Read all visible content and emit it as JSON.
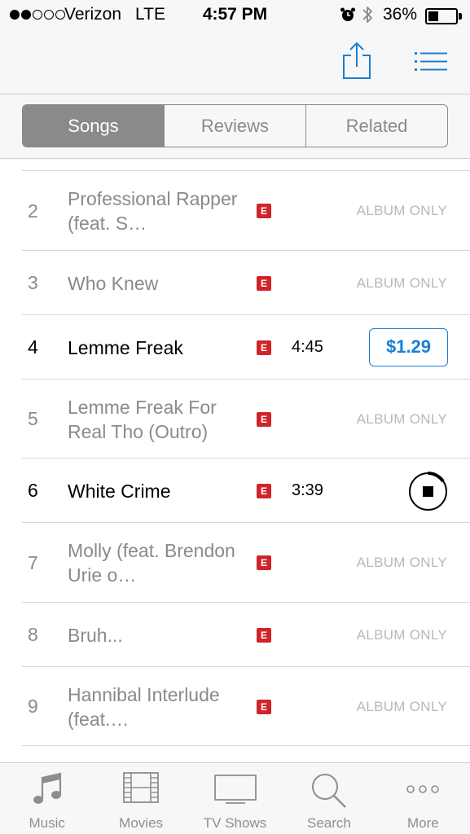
{
  "status_bar": {
    "carrier": "Verizon",
    "network": "LTE",
    "time": "4:57 PM",
    "battery_percent": "36%",
    "battery_level": 0.36,
    "signal_strength": 2,
    "signal_dots_total": 5,
    "icons": [
      "alarm-icon",
      "bluetooth-icon",
      "battery-icon"
    ]
  },
  "nav": {
    "icons": [
      "share-icon",
      "list-icon"
    ],
    "accent_color": "#1a7fd4"
  },
  "segments": {
    "items": [
      "Songs",
      "Reviews",
      "Related"
    ],
    "active_index": 0
  },
  "tracks": [
    {
      "number": "2",
      "title": "Professional Rapper (feat. S…",
      "explicit": "E",
      "status": "ALBUM ONLY"
    },
    {
      "number": "3",
      "title": "Who Knew",
      "explicit": "E",
      "status": "ALBUM ONLY"
    },
    {
      "number": "4",
      "title": "Lemme Freak",
      "explicit": "E",
      "duration": "4:45",
      "price": "$1.29"
    },
    {
      "number": "5",
      "title": "Lemme Freak For Real Tho (Outro)",
      "explicit": "E",
      "status": "ALBUM ONLY"
    },
    {
      "number": "6",
      "title": "White Crime",
      "explicit": "E",
      "duration": "3:39",
      "action_icon": "stop-icon"
    },
    {
      "number": "7",
      "title": "Molly (feat. Brendon Urie o…",
      "explicit": "E",
      "status": "ALBUM ONLY"
    },
    {
      "number": "8",
      "title": "Bruh...",
      "explicit": "E",
      "status": "ALBUM ONLY"
    },
    {
      "number": "9",
      "title": "Hannibal Interlude (feat.…",
      "explicit": "E",
      "status": "ALBUM ONLY"
    }
  ],
  "explicit_color": "#d1232a",
  "tab_bar": {
    "items": [
      {
        "label": "Music",
        "icon": "music-note-icon"
      },
      {
        "label": "Movies",
        "icon": "film-icon"
      },
      {
        "label": "TV Shows",
        "icon": "tv-icon"
      },
      {
        "label": "Search",
        "icon": "search-icon"
      },
      {
        "label": "More",
        "icon": "more-icon"
      }
    ]
  }
}
